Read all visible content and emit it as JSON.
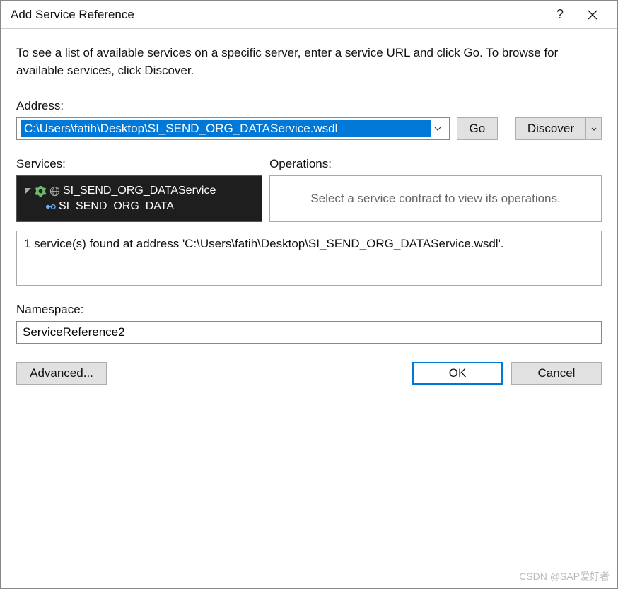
{
  "title": "Add Service Reference",
  "instructions": "To see a list of available services on a specific server, enter a service URL and click Go. To browse for available services, click Discover.",
  "labels": {
    "address": "Address:",
    "services": "Services:",
    "operations": "Operations:",
    "namespace": "Namespace:"
  },
  "address": {
    "value": "C:\\Users\\fatih\\Desktop\\SI_SEND_ORG_DATAService.wsdl"
  },
  "buttons": {
    "go": "Go",
    "discover": "Discover",
    "advanced": "Advanced...",
    "ok": "OK",
    "cancel": "Cancel"
  },
  "tree": {
    "root": "SI_SEND_ORG_DATAService",
    "child": "SI_SEND_ORG_DATA"
  },
  "operations_placeholder": "Select a service contract to view its operations.",
  "status": "1 service(s) found at address 'C:\\Users\\fatih\\Desktop\\SI_SEND_ORG_DATAService.wsdl'.",
  "namespace_value": "ServiceReference2",
  "watermark": "CSDN @SAP爱好者"
}
